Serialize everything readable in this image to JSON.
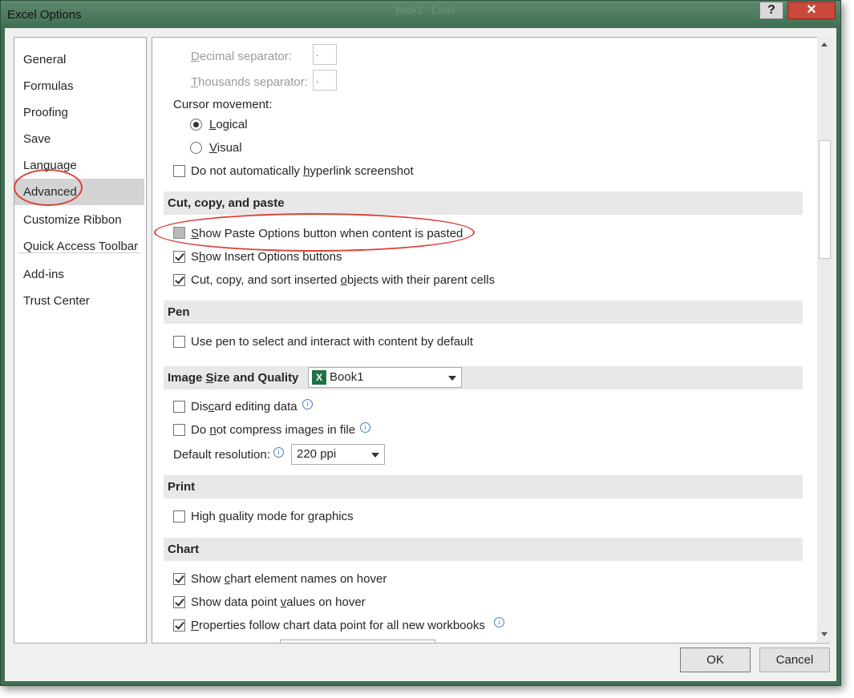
{
  "window": {
    "title": "Excel Options",
    "background_title": "Book1 - Excel",
    "help_label": "?",
    "close_label": "✕"
  },
  "nav": {
    "items": [
      {
        "label": "General"
      },
      {
        "label": "Formulas"
      },
      {
        "label": "Proofing"
      },
      {
        "label": "Save"
      },
      {
        "label": "Language"
      },
      {
        "label": "Advanced",
        "selected": true
      },
      {
        "label": "Customize Ribbon"
      },
      {
        "label": "Quick Access Toolbar"
      },
      {
        "label": "Add-ins"
      },
      {
        "label": "Trust Center"
      }
    ]
  },
  "editing": {
    "decimal_separator": {
      "label_u": "D",
      "label_rest": "ecimal separator:",
      "value": "."
    },
    "thousands_separator": {
      "label_u": "T",
      "label_rest": "housands separator:",
      "value": ","
    },
    "cursor_movement_label": "Cursor movement:",
    "cursor_logical": {
      "label_u": "L",
      "label_rest": "ogical",
      "selected": true
    },
    "cursor_visual": {
      "label_u": "V",
      "label_rest": "isual",
      "selected": false
    },
    "no_auto_hyperlink": {
      "pre": "Do not automatically ",
      "u": "h",
      "post": "yperlink screenshot",
      "checked": false
    }
  },
  "sections": {
    "cut_copy_paste": "Cut, copy, and paste",
    "pen": "Pen",
    "image_size_quality": {
      "pre": "Image ",
      "u": "S",
      "post": "ize and Quality"
    },
    "print": "Print",
    "chart": "Chart"
  },
  "cut_copy_paste": {
    "show_paste_options": {
      "u": "S",
      "post": "how Paste Options button when content is pasted",
      "checked": false
    },
    "show_insert_options": {
      "pre": "S",
      "u": "h",
      "post": "ow Insert Options buttons",
      "checked": true
    },
    "cut_copy_sort": {
      "pre": "Cut, copy, and sort inserted ",
      "u": "o",
      "post": "bjects with their parent cells",
      "checked": true
    }
  },
  "pen": {
    "use_pen": {
      "label": "Use pen to select and interact with content by default",
      "checked": false
    }
  },
  "image": {
    "workbook": "Book1",
    "discard_editing": {
      "pre": "Dis",
      "u": "c",
      "post": "ard editing data",
      "checked": false
    },
    "no_compress": {
      "pre": "Do ",
      "u": "n",
      "post": "ot compress images in file",
      "checked": false
    },
    "default_resolution_label": "Default resolution:",
    "default_resolution_value": "220 ppi"
  },
  "print": {
    "high_quality": {
      "pre": "High ",
      "u": "q",
      "post": "uality mode for graphics",
      "checked": false
    }
  },
  "chart": {
    "element_names": {
      "pre": "Show ",
      "u": "c",
      "post": "hart element names on hover",
      "checked": true
    },
    "data_point_values": {
      "pre": "Show data point ",
      "u": "v",
      "post": "alues on hover",
      "checked": true
    },
    "properties_follow": {
      "pre": "",
      "u": "P",
      "post": "roperties follow chart data point for all new workbooks",
      "checked": true
    }
  },
  "footer": {
    "ok_label": "OK",
    "cancel_label": "Cancel"
  },
  "colors": {
    "titlebar": "#3f6e52",
    "annotation_red": "#d9443a",
    "selected_nav": "#d4d4d4"
  }
}
